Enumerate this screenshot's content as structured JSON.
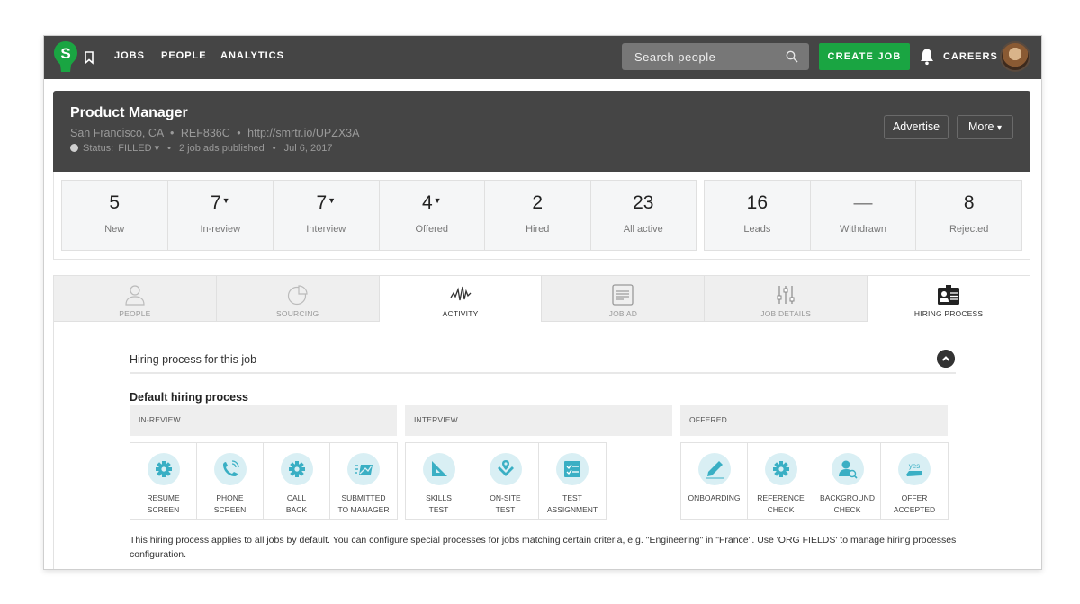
{
  "nav": {
    "logo_letter": "S",
    "links": [
      "JOBS",
      "PEOPLE",
      "ANALYTICS"
    ],
    "search_placeholder": "Search people",
    "create_job_label": "CREATE JOB",
    "careers_label": "CAREERS"
  },
  "job": {
    "title": "Product Manager",
    "location": "San Francisco, CA",
    "ref": "REF836C",
    "url": "http://smrtr.io/UPZX3A",
    "status_label": "Status:",
    "status_value": "FILLED",
    "ads_published": "2 job ads published",
    "date": "Jul 6, 2017",
    "advertise_label": "Advertise",
    "more_label": "More"
  },
  "stats": {
    "pipeline": [
      {
        "value": "5",
        "label": "New",
        "dropdown": false
      },
      {
        "value": "7",
        "label": "In-review",
        "dropdown": true
      },
      {
        "value": "7",
        "label": "Interview",
        "dropdown": true
      },
      {
        "value": "4",
        "label": "Offered",
        "dropdown": true
      },
      {
        "value": "2",
        "label": "Hired",
        "dropdown": false
      },
      {
        "value": "23",
        "label": "All active",
        "dropdown": false
      }
    ],
    "other": [
      {
        "value": "16",
        "label": "Leads"
      },
      {
        "value": "—",
        "label": "Withdrawn"
      },
      {
        "value": "8",
        "label": "Rejected"
      }
    ]
  },
  "tabs": [
    {
      "label": "PEOPLE",
      "icon": "person-icon"
    },
    {
      "label": "SOURCING",
      "icon": "pie-chart-icon"
    },
    {
      "label": "ACTIVITY",
      "icon": "activity-wave-icon"
    },
    {
      "label": "JOB AD",
      "icon": "document-icon"
    },
    {
      "label": "JOB DETAILS",
      "icon": "sliders-icon"
    },
    {
      "label": "HIRING PROCESS",
      "icon": "id-badge-icon"
    }
  ],
  "hiring": {
    "section_title": "Hiring process for this job",
    "default_title": "Default hiring process",
    "stages": [
      {
        "name": "IN-REVIEW",
        "steps": [
          {
            "label": "RESUME\nSCREEN",
            "icon": "gear-icon"
          },
          {
            "label": "PHONE\nSCREEN",
            "icon": "phone-icon"
          },
          {
            "label": "CALL\nBACK",
            "icon": "gear-icon"
          },
          {
            "label": "SUBMITTED\nTO MANAGER",
            "icon": "send-mail-icon"
          }
        ]
      },
      {
        "name": "INTERVIEW",
        "steps": [
          {
            "label": "SKILLS\nTEST",
            "icon": "set-square-icon"
          },
          {
            "label": "ON-SITE\nTEST",
            "icon": "location-check-icon"
          },
          {
            "label": "TEST\nASSIGNMENT",
            "icon": "checklist-icon"
          }
        ]
      },
      {
        "name": "OFFERED",
        "steps": [
          {
            "label": "ONBOARDING",
            "icon": "pen-icon"
          },
          {
            "label": "REFERENCE\nCHECK",
            "icon": "gear-icon"
          },
          {
            "label": "BACKGROUND\nCHECK",
            "icon": "person-search-icon"
          },
          {
            "label": "OFFER\nACCEPTED",
            "icon": "yes-icon"
          }
        ]
      }
    ],
    "footnote": "This hiring process applies to all jobs by default. You can configure special processes for jobs matching certain criteria, e.g. \"Engineering\" in \"France\". Use 'ORG FIELDS' to manage hiring processes configuration."
  },
  "colors": {
    "nav_bg": "#454545",
    "brand_green": "#1aa542",
    "step_icon": "#3aafc4",
    "step_circle": "#d9eff4"
  }
}
